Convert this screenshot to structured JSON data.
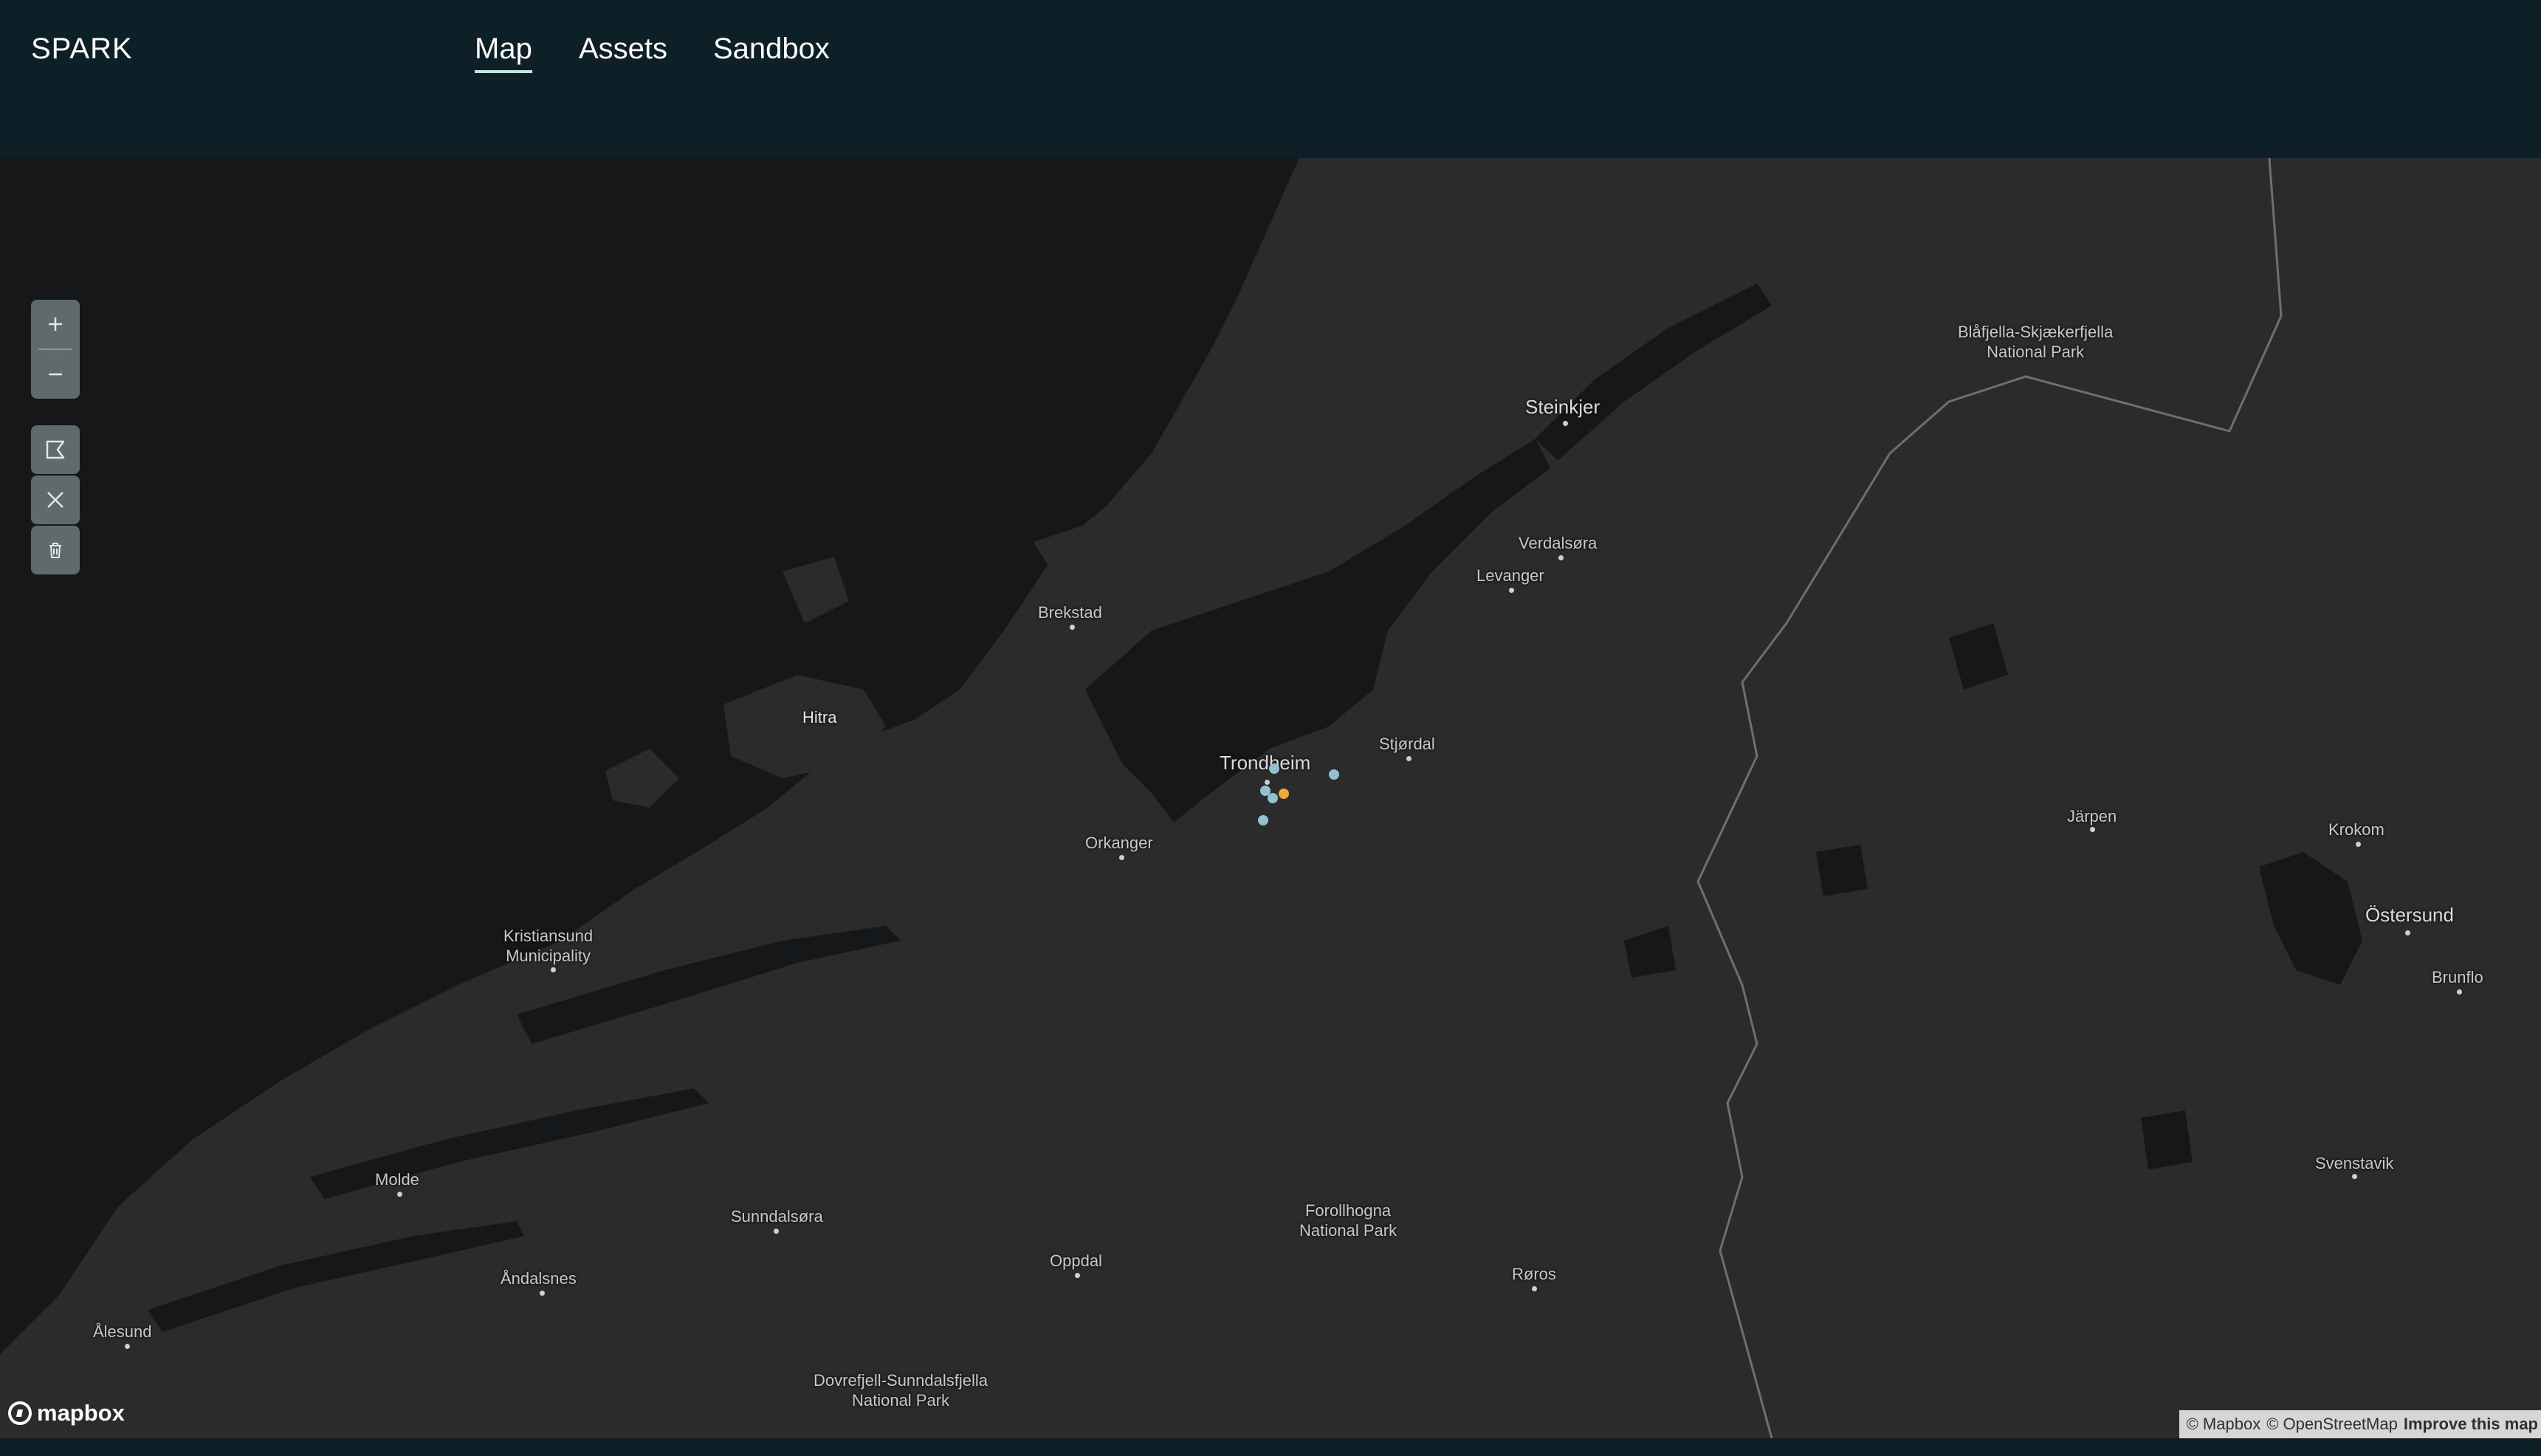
{
  "app": {
    "title": "SPARK"
  },
  "nav": {
    "items": [
      {
        "label": "Map",
        "active": true
      },
      {
        "label": "Assets",
        "active": false
      },
      {
        "label": "Sandbox",
        "active": false
      }
    ]
  },
  "map_controls": {
    "zoom_in_icon": "plus-icon",
    "zoom_out_icon": "minus-icon",
    "draw_polygon_icon": "polygon-icon",
    "cancel_icon": "close-icon",
    "delete_icon": "trash-icon"
  },
  "map": {
    "places": [
      {
        "id": "steinkjer",
        "text": "Steinkjer"
      },
      {
        "id": "blafjella",
        "text": "Blåfjella-Skjækerfjella\nNational Park"
      },
      {
        "id": "verdalsora",
        "text": "Verdalsøra"
      },
      {
        "id": "levanger",
        "text": "Levanger"
      },
      {
        "id": "brekstad",
        "text": "Brekstad"
      },
      {
        "id": "hitra",
        "text": "Hitra"
      },
      {
        "id": "trondheim",
        "text": "Trondheim"
      },
      {
        "id": "stjordal",
        "text": "Stjørdal"
      },
      {
        "id": "orkanger",
        "text": "Orkanger"
      },
      {
        "id": "jarpen",
        "text": "Järpen"
      },
      {
        "id": "krokom",
        "text": "Krokom"
      },
      {
        "id": "ostersund",
        "text": "Östersund"
      },
      {
        "id": "brunflo",
        "text": "Brunflo"
      },
      {
        "id": "kristiansund",
        "text": "Kristiansund\nMunicipality"
      },
      {
        "id": "molde",
        "text": "Molde"
      },
      {
        "id": "sunndalsora",
        "text": "Sunndalsøra"
      },
      {
        "id": "andalsnes",
        "text": "Åndalsnes"
      },
      {
        "id": "alesund",
        "text": "Ålesund"
      },
      {
        "id": "oppdal",
        "text": "Oppdal"
      },
      {
        "id": "forollhogna",
        "text": "Forollhogna\nNational Park"
      },
      {
        "id": "roros",
        "text": "Røros"
      },
      {
        "id": "svenstavik",
        "text": "Svenstavik"
      },
      {
        "id": "dovrefjell",
        "text": "Dovrefjell-Sunndalsfjella\nNational Park"
      }
    ],
    "markers": [
      {
        "id": "m1",
        "color": "#8fc4cf"
      },
      {
        "id": "m2",
        "color": "#8fc4cf"
      },
      {
        "id": "m3",
        "color": "#8fc4cf"
      },
      {
        "id": "m4",
        "color": "#f0a83c"
      },
      {
        "id": "m5",
        "color": "#8fc4cf"
      },
      {
        "id": "m6",
        "color": "#8fc4cf"
      }
    ]
  },
  "logo": {
    "text": "mapbox"
  },
  "attribution": {
    "mapbox": "© Mapbox",
    "osm": "© OpenStreetMap",
    "improve": "Improve this map"
  }
}
